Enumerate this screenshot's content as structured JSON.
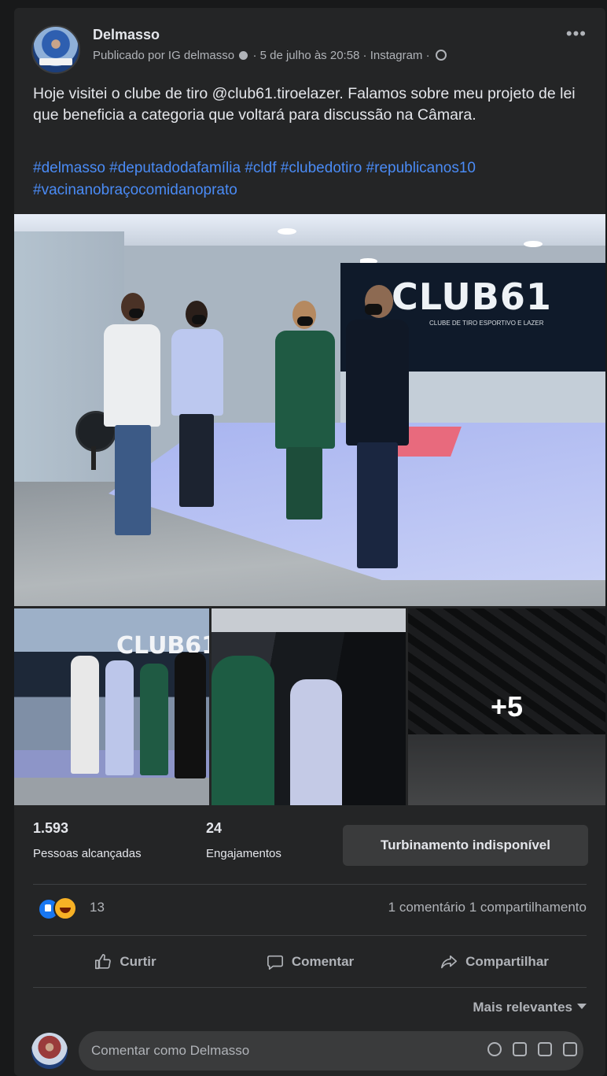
{
  "post": {
    "author": "Delmasso",
    "meta_prefix": "Publicado por IG delmasso",
    "meta_suffix": "· 5 de julho às 20:58 · Instagram ·",
    "text": "Hoje visitei o clube de tiro @club61.tiroelazer. Falamos sobre meu projeto de lei que beneficia a categoria que voltará para discussão na Câmara.",
    "hashtags": "#delmasso #deputadodafamília #cldf #clubedotiro #republicanos10 #vacinanobraçocomidanoprato",
    "more_label": "•••"
  },
  "photos": {
    "main_logo": "CLUB61",
    "main_logo_sub": "CLUBE DE TIRO ESPORTIVO E LAZER",
    "thumb1_logo": "CLUB61",
    "more_overlay": "+5"
  },
  "stats": {
    "reached_value": "1.593",
    "reached_label": "Pessoas alcançadas",
    "engagement_value": "24",
    "engagement_label": "Engajamentos",
    "boost_label": "Turbinamento indisponível"
  },
  "reactions": {
    "count": "13",
    "comments": "1 comentário",
    "shares": "1 compartilhamento"
  },
  "actions": {
    "like": "Curtir",
    "comment": "Comentar",
    "share": "Compartilhar"
  },
  "sort_label": "Mais relevantes",
  "comment_box": {
    "placeholder": "Comentar como Delmasso"
  },
  "colors": {
    "background": "#18191a",
    "card": "#242526",
    "link": "#4a8bf5",
    "button": "#3a3b3c"
  }
}
